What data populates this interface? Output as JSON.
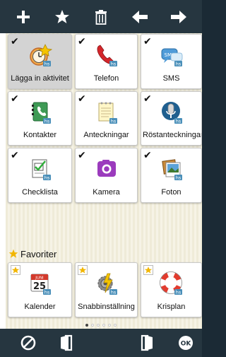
{
  "toolbar": {
    "buttons": [
      {
        "icon": "plus-icon"
      },
      {
        "icon": "star-icon"
      },
      {
        "icon": "trash-icon"
      },
      {
        "icon": "arrow-left-icon"
      },
      {
        "icon": "arrow-right-icon"
      }
    ]
  },
  "apps": [
    {
      "label": "Lägga in aktivitet",
      "checked": true,
      "selected": true
    },
    {
      "label": "Telefon",
      "checked": true,
      "selected": false
    },
    {
      "label": "SMS",
      "checked": true,
      "selected": false
    },
    {
      "label": "Kontakter",
      "checked": true,
      "selected": false
    },
    {
      "label": "Anteckningar",
      "checked": true,
      "selected": false
    },
    {
      "label": "Röstanteckningar",
      "checked": true,
      "selected": false
    },
    {
      "label": "Checklista",
      "checked": true,
      "selected": false
    },
    {
      "label": "Kamera",
      "checked": true,
      "selected": false
    },
    {
      "label": "Foton",
      "checked": true,
      "selected": false
    }
  ],
  "favorites": {
    "title": "Favoriter",
    "items": [
      {
        "label": "Kalender",
        "calendar_month": "JUNI",
        "calendar_day": "25"
      },
      {
        "label": "Snabbinställning"
      },
      {
        "label": "Krisplan"
      }
    ]
  },
  "pager": {
    "count": 6,
    "active_index": 0
  },
  "bottombar": {
    "buttons": [
      {
        "icon": "cancel-icon"
      },
      {
        "icon": "exit-left-icon"
      },
      {
        "icon": "exit-right-icon"
      },
      {
        "icon": "ok-icon",
        "label": "OK"
      }
    ]
  },
  "colors": {
    "bar": "#263640",
    "background_stripe": "#efebd8",
    "badge_hs": "#4a8fb9"
  }
}
